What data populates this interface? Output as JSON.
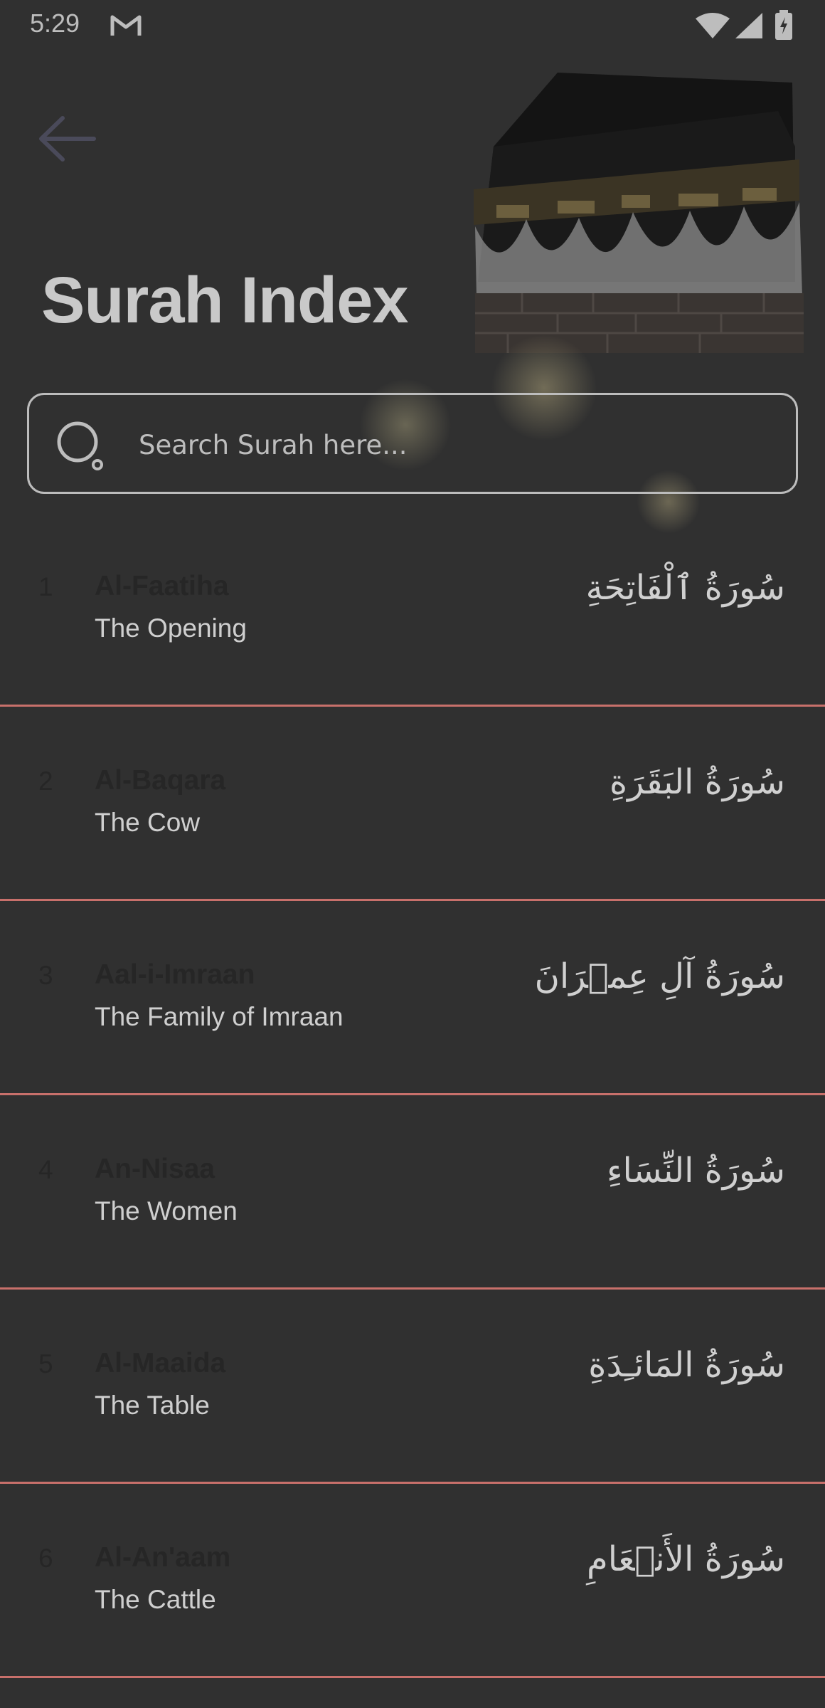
{
  "status_bar": {
    "time": "5:29",
    "icons": [
      "gmail-icon",
      "wifi-icon",
      "signal-icon",
      "battery-charging-icon"
    ]
  },
  "header": {
    "back_icon": "arrow-left-icon",
    "title": "Surah Index",
    "image": "kaaba-image"
  },
  "search": {
    "icon": "search-icon",
    "placeholder": "Search Surah here...",
    "value": ""
  },
  "colors": {
    "background": "#303030",
    "divider": "#c8706b",
    "number_and_name": "#262626",
    "text_light": "#cfcfcf"
  },
  "surahs": [
    {
      "number": "1",
      "name": "Al-Faatiha",
      "translation": "The Opening",
      "arabic": "سُورَةُ ٱلْفَاتِحَةِ"
    },
    {
      "number": "2",
      "name": "Al-Baqara",
      "translation": "The Cow",
      "arabic": "سُورَةُ البَقَرَةِ"
    },
    {
      "number": "3",
      "name": "Aal-i-Imraan",
      "translation": "The Family of Imraan",
      "arabic": "سُورَةُ آلِ عِمۡرَانَ"
    },
    {
      "number": "4",
      "name": "An-Nisaa",
      "translation": "The Women",
      "arabic": "سُورَةُ النِّسَاءِ"
    },
    {
      "number": "5",
      "name": "Al-Maaida",
      "translation": "The Table",
      "arabic": "سُورَةُ المَائـِدَةِ"
    },
    {
      "number": "6",
      "name": "Al-An'aam",
      "translation": "The Cattle",
      "arabic": "سُورَةُ الأَنۡعَامِ"
    }
  ]
}
